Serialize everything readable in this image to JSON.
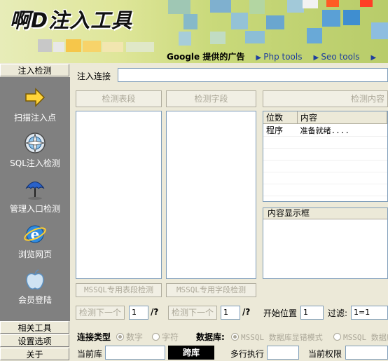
{
  "app": {
    "title": "啊D注入工具"
  },
  "ads": {
    "google": "Google 提供的广告",
    "links": [
      "Php tools",
      "Seo tools"
    ]
  },
  "sidebar": {
    "header": "注入检测",
    "items": [
      {
        "label": "扫描注入点",
        "icon": "arrow-icon"
      },
      {
        "label": "SQL注入检测",
        "icon": "compass-icon"
      },
      {
        "label": "管理入口检测",
        "icon": "umbrella-icon"
      },
      {
        "label": "浏览网页",
        "icon": "ie-icon"
      },
      {
        "label": "会员登陆",
        "icon": "apple-icon"
      }
    ],
    "footer": [
      "相关工具",
      "设置选项",
      "关于"
    ]
  },
  "main": {
    "url_label": "注入连接",
    "url_value": "",
    "btn_detect_tables": "检测表段",
    "btn_detect_fields": "检测字段",
    "btn_detect_content": "检测内容",
    "grid": {
      "columns": [
        "位数",
        "内容"
      ],
      "rows": [
        [
          "程序",
          "准备就绪...."
        ]
      ]
    },
    "content_box_title": "内容显示框",
    "btn_mssql_tables": "MSSQL专用表段检测",
    "btn_mssql_fields": "MSSQL专用字段检测",
    "btn_next_1": "检测下一个",
    "page_1": "1",
    "slash_1": "/?",
    "btn_next_2": "检测下一个",
    "page_2": "1",
    "slash_2": "/?",
    "start_pos_label": "开始位置",
    "start_pos_value": "1",
    "filter_label": "过滤:",
    "filter_value": "1=1",
    "conn_type_label": "连接类型",
    "conn_options": [
      "数字",
      "字符"
    ],
    "db_label": "数据库:",
    "db_options": [
      "MSSQL 数据库显错模式",
      "MSSQL 数据库"
    ],
    "current_db_label": "当前库",
    "cross_db_label": "跨库",
    "multi_exec_label": "多行执行",
    "current_perm_label": "当前权限"
  }
}
